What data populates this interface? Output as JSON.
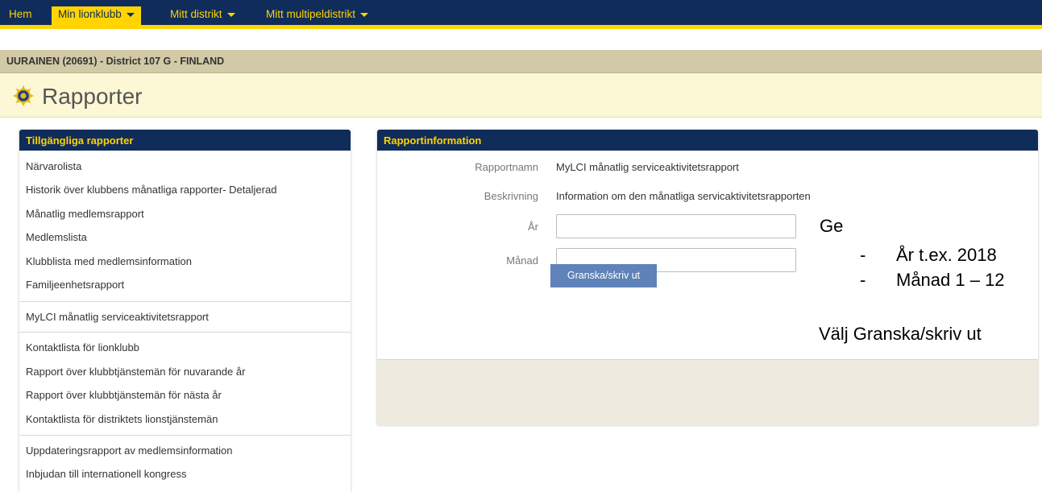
{
  "nav": {
    "home": "Hem",
    "my_club": "Min lionklubb",
    "my_district": "Mitt distrikt",
    "my_multiple_district": "Mitt multipeldistrikt"
  },
  "club_info": "UURAINEN (20691) - District 107 G - FINLAND",
  "page": {
    "title": "Rapporter"
  },
  "available_reports": {
    "header": "Tillgängliga rapporter",
    "items": [
      "Närvarolista",
      "Historik över klubbens månatliga rapporter- Detaljerad",
      "Månatlig medlemsrapport",
      "Medlemslista",
      "Klubblista med medlemsinformation",
      "Familjeenhetsrapport",
      "MyLCI månatlig serviceaktivitetsrapport",
      "Kontaktlista för lionklubb",
      "Rapport över klubbtjänstemän för nuvarande år",
      "Rapport över klubbtjänstemän för nästa år",
      "Kontaktlista för distriktets lionstjänstemän",
      "Uppdateringsrapport av medlemsinformation",
      "Inbjudan till internationell kongress"
    ]
  },
  "report_info": {
    "header": "Rapportinformation",
    "name_label": "Rapportnamn",
    "name_value": "MyLCI månatlig serviceaktivitetsrapport",
    "description_label": "Beskrivning",
    "description_value": "Information om den månatliga servicaktivitetsrapporten",
    "year_label": "År",
    "year_value": "",
    "month_label": "Månad",
    "month_value": "",
    "preview_button": "Granska/skriv ut"
  },
  "annotation": {
    "intro": "Ge",
    "bullet_dash": "-",
    "bullet_year": "År t.ex. 2018",
    "bullet_month": "Månad 1 – 12",
    "instruction": "Välj Granska/skriv ut"
  }
}
